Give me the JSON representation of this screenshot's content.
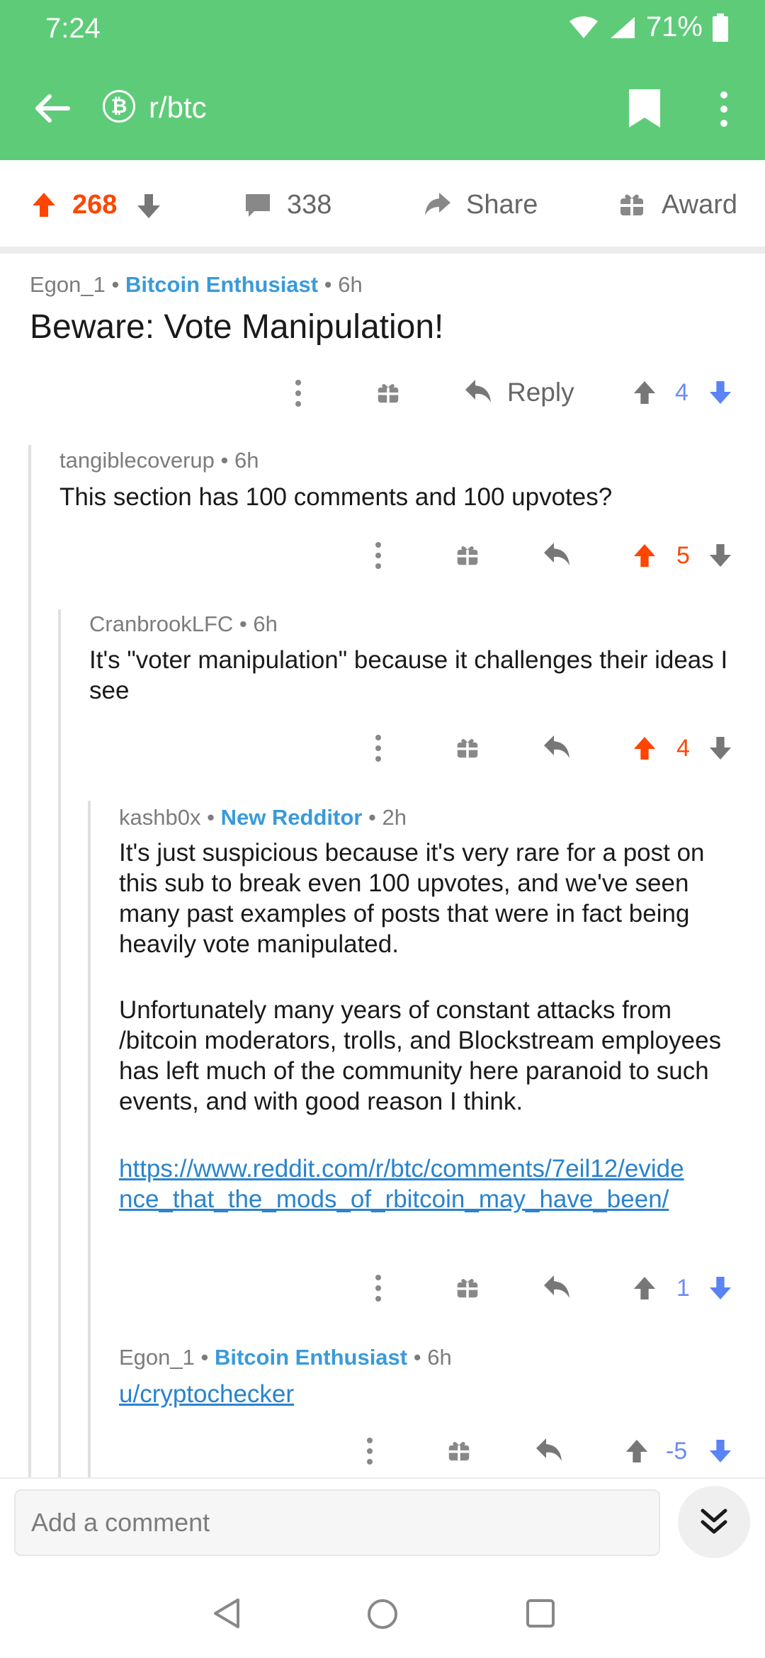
{
  "status": {
    "time": "7:24",
    "battery": "71%"
  },
  "header": {
    "subreddit": "r/btc",
    "back_icon": "back-arrow-icon",
    "bookmark_icon": "bookmark-icon",
    "more_icon": "more-vert-icon",
    "color": "#5ecb79"
  },
  "post_bar": {
    "score": "268",
    "comments": "338",
    "share_label": "Share",
    "award_label": "Award",
    "upvote_color": "#ff4500"
  },
  "op": {
    "author": "Egon_1",
    "flair": "Bitcoin Enthusiast",
    "time": "6h",
    "title": "Beware: Vote Manipulation!",
    "reply_label": "Reply",
    "score": "4"
  },
  "comments": [
    {
      "author": "tangiblecoverup",
      "time": "6h",
      "text": "This section has 100 comments and 100 upvotes?",
      "score": "5"
    },
    {
      "author": "CranbrookLFC",
      "time": "6h",
      "text": "It's \"voter manipulation\" because it challenges their ideas I see",
      "score": "4"
    },
    {
      "author": "kashb0x",
      "flair": "New Redditor",
      "time": "2h",
      "p1": "It's just suspicious because it's very rare for a post on this sub to break even 100 upvotes, and we've seen many past examples of posts that were in fact being heavily vote manipulated.",
      "p2": "Unfortunately many years of constant attacks from /bitcoin moderators, trolls, and Blockstream employees has left much of the community here paranoid to such events, and with good reason I think.",
      "link": "https://www.reddit.com/r/btc/comments/7eil12/evidence_that_the_mods_of_rbitcoin_may_have_been/",
      "score": "1"
    },
    {
      "author": "Egon_1",
      "flair": "Bitcoin Enthusiast",
      "time": "6h",
      "link": "u/cryptochecker",
      "score": "-5"
    }
  ],
  "composer": {
    "placeholder": "Add a comment"
  }
}
